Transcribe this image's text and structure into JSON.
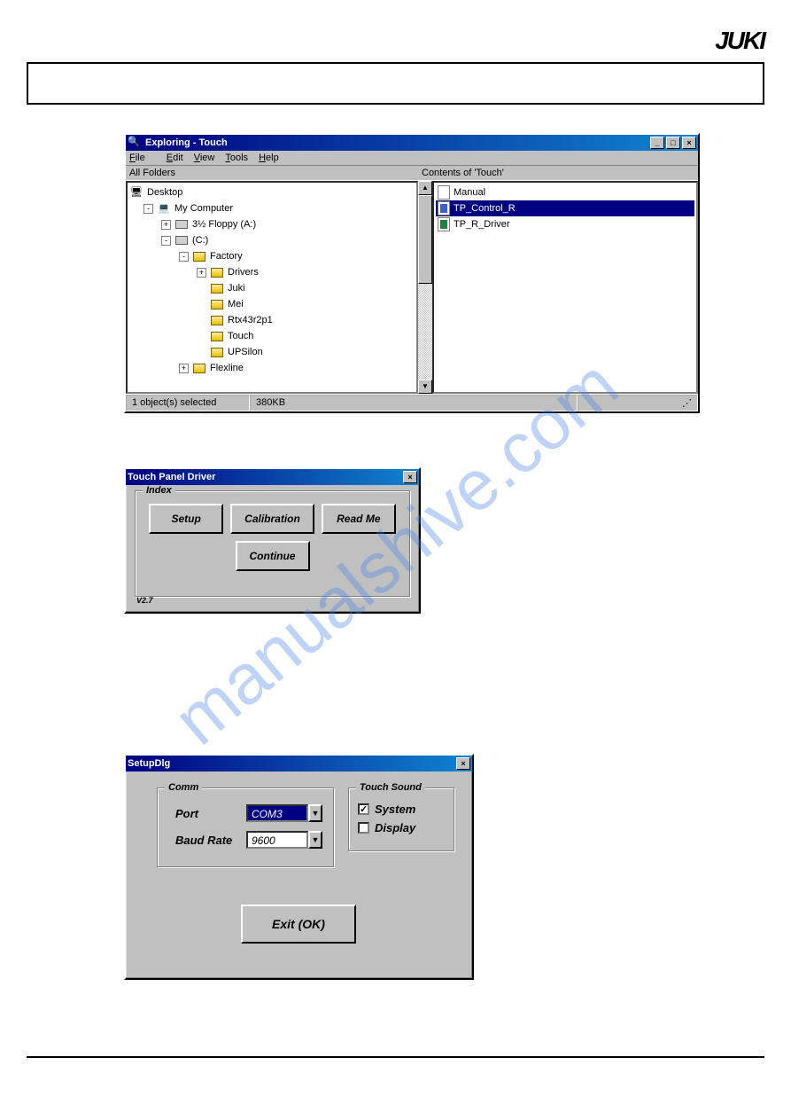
{
  "logo": "JUKI",
  "watermark": "manualshive.com",
  "explorer": {
    "title": "Exploring - Touch",
    "menu": {
      "file": "File",
      "edit": "Edit",
      "view": "View",
      "tools": "Tools",
      "help": "Help"
    },
    "left_header": "All Folders",
    "right_header": "Contents of 'Touch'",
    "tree": {
      "desktop": "Desktop",
      "mycomputer": "My Computer",
      "floppy": "3½ Floppy (A:)",
      "c_drive": "(C:)",
      "factory": "Factory",
      "drivers": "Drivers",
      "juki": "Juki",
      "mei": "Mei",
      "rtx": "Rtx43r2p1",
      "touch": "Touch",
      "upsilon": "UPSilon",
      "flexline": "Flexline"
    },
    "files": {
      "manual": "Manual",
      "tp_control": "TP_Control_R",
      "tp_driver": "TP_R_Driver"
    },
    "status": {
      "selected": "1 object(s) selected",
      "size": "380KB"
    }
  },
  "tpdriver": {
    "title": "Touch Panel Driver",
    "group": "Index",
    "setup": "Setup",
    "calibration": "Calibration",
    "readme": "Read Me",
    "continue": "Continue",
    "version": "V2.7"
  },
  "setupdlg": {
    "title": "SetupDlg",
    "comm_label": "Comm",
    "port_label": "Port",
    "port_value": "COM3",
    "baud_label": "Baud Rate",
    "baud_value": "9600",
    "touch_label": "Touch Sound",
    "system": "System",
    "display": "Display",
    "exit": "Exit (OK)"
  }
}
